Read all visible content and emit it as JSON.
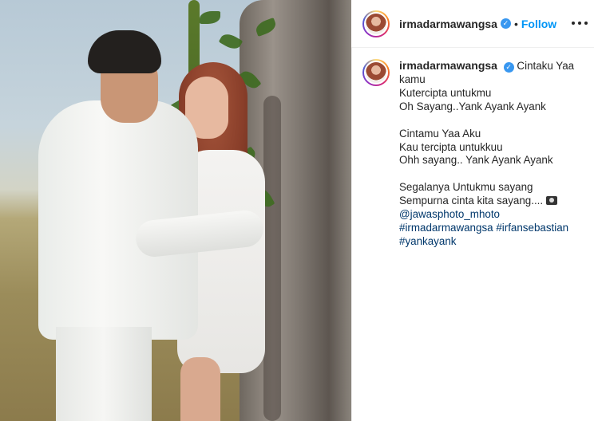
{
  "post": {
    "username": "irmadarmawangsa",
    "verified": true,
    "dot": "•",
    "follow_label": "Follow",
    "more_icon": "more-options-icon"
  },
  "caption": {
    "username": "irmadarmawangsa",
    "first_line": "Cintaku Yaa",
    "lines": [
      "kamu",
      "Kutercipta untukmu",
      "Oh Sayang..Yank Ayank Ayank",
      "",
      "Cintamu Yaa Aku",
      "Kau tercipta untukkuu",
      "Ohh sayang.. Yank Ayank Ayank",
      "",
      "Segalanya Untukmu sayang",
      "Sempurna cinta kita sayang...."
    ],
    "mention": "@jawasphoto_mhoto",
    "hashtags_line1": "#irmadarmawangsa #irfansebastian",
    "hashtags_line2": "#yankayank"
  },
  "colors": {
    "link": "#00376b",
    "follow": "#0095f6",
    "verified": "#3897f0"
  }
}
